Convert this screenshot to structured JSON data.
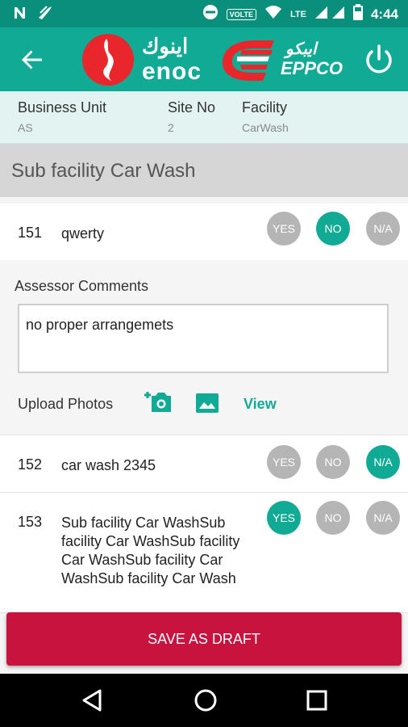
{
  "status": {
    "time": "4:44",
    "volte": "VOLTE",
    "lte": "LTE"
  },
  "header": {
    "brand_left": "enoc",
    "brand_left_ar": "اينوك",
    "brand_right": "EPPCO",
    "brand_right_ar": "ايبكو",
    "accent": "#11ab95",
    "brand_red": "#e8262b"
  },
  "info": {
    "business_unit_label": "Business Unit",
    "business_unit_value": "AS",
    "site_no_label": "Site No",
    "site_no_value": "2",
    "facility_label": "Facility",
    "facility_value": "CarWash"
  },
  "section_title": "Sub facility Car Wash",
  "options": {
    "yes": "YES",
    "no": "NO",
    "na": "N/A"
  },
  "questions": [
    {
      "num": "151",
      "text": "qwerty",
      "selected": "no"
    },
    {
      "num": "152",
      "text": "car wash 2345",
      "selected": "na"
    },
    {
      "num": "153",
      "text": "Sub facility Car WashSub facility Car WashSub facility Car WashSub facility Car WashSub facility Car Wash",
      "selected": "yes"
    }
  ],
  "comments": {
    "title": "Assessor Comments",
    "value": "no proper arrangemets",
    "upload_label": "Upload Photos",
    "view_label": "View"
  },
  "save_draft": "SAVE AS DRAFT",
  "icons": [
    "n-icon",
    "bird-icon",
    "dnd-icon",
    "wifi-icon",
    "signal-icon",
    "battery-icon",
    "back-arrow-icon",
    "power-icon",
    "add-photo-icon",
    "image-icon",
    "nav-back-icon",
    "nav-home-icon",
    "nav-recents-icon"
  ]
}
